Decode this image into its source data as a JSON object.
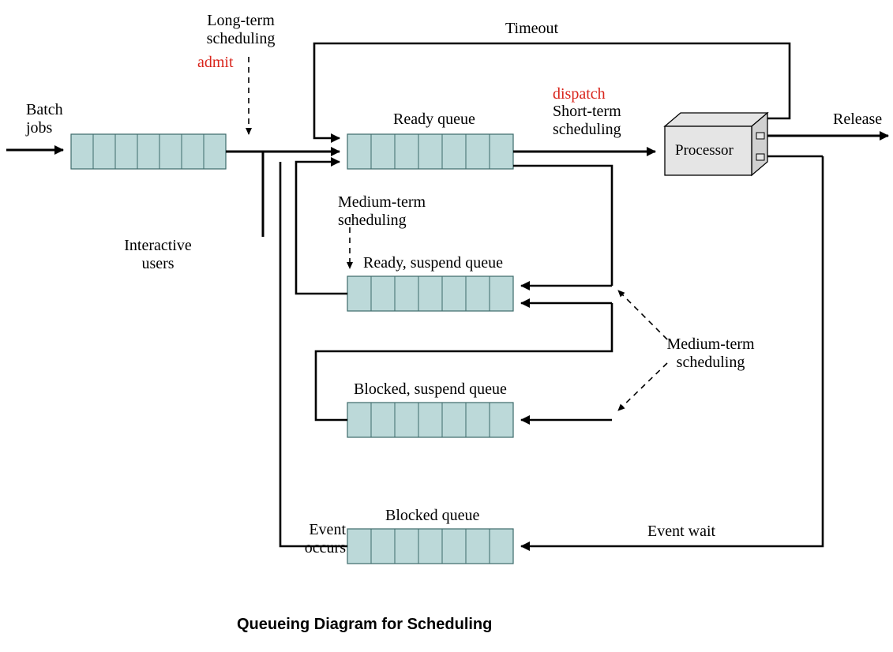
{
  "caption": "Queueing Diagram for Scheduling",
  "labels": {
    "batch_jobs": "Batch\njobs",
    "long_term": "Long-term\nscheduling",
    "admit": "admit",
    "interactive": "Interactive\nusers",
    "ready_queue": "Ready queue",
    "dispatch": "dispatch",
    "short_term": "Short-term\nscheduling",
    "timeout": "Timeout",
    "processor": "Processor",
    "release": "Release",
    "medium_term_top": "Medium-term\nscheduling",
    "ready_suspend": "Ready, suspend queue",
    "medium_term_right": "Medium-term\nscheduling",
    "blocked_suspend": "Blocked, suspend queue",
    "blocked_queue": "Blocked queue",
    "event_occurs": "Event\noccurs",
    "event_wait": "Event wait"
  },
  "queues": {
    "slots": 7,
    "fill": "#bcd9d9",
    "stroke": "#3c6a6a"
  },
  "processor_box": {
    "fill": "#e5e5e5",
    "stroke": "#000"
  }
}
